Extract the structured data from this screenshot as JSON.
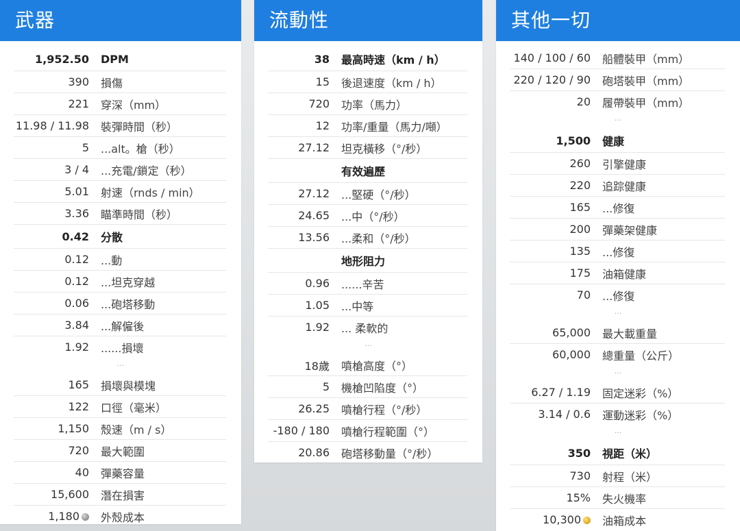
{
  "panels": {
    "weapon": {
      "title": "武器",
      "rows": [
        {
          "value": "1,952.50",
          "label": "DPM",
          "bold": true
        },
        {
          "value": "390",
          "label": "損傷"
        },
        {
          "value": "221",
          "label": "穿深（mm）"
        },
        {
          "value": "11.98 / 11.98",
          "label": "裝彈時間（秒）"
        },
        {
          "value": "5",
          "label": "...alt。槍（秒）"
        },
        {
          "value": "3 / 4",
          "label": "...充電/鎖定（秒）"
        },
        {
          "value": "5.01",
          "label": "射速（rnds / min）"
        },
        {
          "value": "3.36",
          "label": "瞄準時間（秒）"
        },
        {
          "value": "0.42",
          "label": "分散",
          "bold": true
        },
        {
          "value": "0.12",
          "label": "...動"
        },
        {
          "value": "0.12",
          "label": "...坦克穿越"
        },
        {
          "value": "0.06",
          "label": "...砲塔移動"
        },
        {
          "value": "3.84",
          "label": "...解僱後"
        },
        {
          "value": "1.92",
          "label": "......損壞",
          "nob": true
        },
        {
          "gap": "..."
        },
        {
          "value": "165",
          "label": "損壞與模塊"
        },
        {
          "value": "122",
          "label": "口徑（毫米）"
        },
        {
          "value": "1,150",
          "label": "殼速（m / s）"
        },
        {
          "value": "720",
          "label": "最大範圍"
        },
        {
          "value": "40",
          "label": "彈藥容量"
        },
        {
          "value": "15,600",
          "label": "潛在損害"
        },
        {
          "value": "1,180",
          "label": "外殼成本",
          "coin": "silver",
          "nob": true
        }
      ]
    },
    "mobility": {
      "title": "流動性",
      "rows": [
        {
          "value": "38",
          "label": "最高時速（km / h）",
          "bold": true
        },
        {
          "value": "15",
          "label": "後退速度（km / h）"
        },
        {
          "value": "720",
          "label": "功率（馬力）"
        },
        {
          "value": "12",
          "label": "功率/重量（馬力/噸）"
        },
        {
          "value": "27.12",
          "label": "坦克橫移（°/秒）"
        },
        {
          "value": "",
          "label": "有效遍歷",
          "bold": true
        },
        {
          "value": "27.12",
          "label": "...堅硬（°/秒）"
        },
        {
          "value": "24.65",
          "label": "...中（°/秒）"
        },
        {
          "value": "13.56",
          "label": "...柔和（°/秒）"
        },
        {
          "value": "",
          "label": "地形阻力",
          "bold": true
        },
        {
          "value": "0.96",
          "label": "......辛苦"
        },
        {
          "value": "1.05",
          "label": "...中等"
        },
        {
          "value": "1.92",
          "label": "... 柔軟的",
          "nob": true
        },
        {
          "gap": "..."
        },
        {
          "value": "18歲",
          "label": "噴槍高度（°）"
        },
        {
          "value": "5",
          "label": "機槍凹陷度（°）"
        },
        {
          "value": "26.25",
          "label": "噴槍行程（°/秒）"
        },
        {
          "value": "-180 / 180",
          "label": "噴槍行程範圍（°）"
        },
        {
          "value": "20.86",
          "label": "砲塔移動量（°/秒）",
          "nob": true
        }
      ]
    },
    "other": {
      "title": "其他一切",
      "rows": [
        {
          "value": "140 / 100 / 60",
          "label": "船體裝甲（mm）"
        },
        {
          "value": "220 / 120 / 90",
          "label": "砲塔裝甲（mm）"
        },
        {
          "value": "20",
          "label": "履帶裝甲（mm）",
          "nob": true
        },
        {
          "gap": "..."
        },
        {
          "value": "1,500",
          "label": "健康",
          "bold": true
        },
        {
          "value": "260",
          "label": "引擎健康"
        },
        {
          "value": "220",
          "label": "追踪健康"
        },
        {
          "value": "165",
          "label": "...修復"
        },
        {
          "value": "200",
          "label": "彈藥架健康"
        },
        {
          "value": "135",
          "label": "...修復"
        },
        {
          "value": "175",
          "label": "油箱健康"
        },
        {
          "value": "70",
          "label": "...修復",
          "nob": true
        },
        {
          "gap": "..."
        },
        {
          "value": "65,000",
          "label": "最大載重量"
        },
        {
          "value": "60,000",
          "label": "總重量（公斤）",
          "nob": true
        },
        {
          "gap": "..."
        },
        {
          "value": "6.27 / 1.19",
          "label": "固定迷彩（%）"
        },
        {
          "value": "3.14 / 0.6",
          "label": "運動迷彩（%）",
          "nob": true
        },
        {
          "gap": "..."
        },
        {
          "value": "350",
          "label": "視距（米）",
          "bold": true
        },
        {
          "value": "730",
          "label": "射程（米）"
        },
        {
          "value": "15%",
          "label": "失火機率"
        },
        {
          "value": "10,300",
          "label": "油箱成本",
          "coin": "gold",
          "nob": true
        }
      ]
    }
  }
}
